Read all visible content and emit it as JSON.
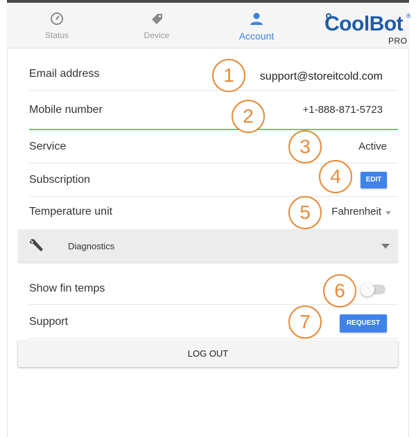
{
  "nav": {
    "tabs": [
      {
        "label": "Status",
        "icon": "speedometer-icon"
      },
      {
        "label": "Device",
        "icon": "tag-icon"
      },
      {
        "label": "Account",
        "icon": "person-icon",
        "active": true
      }
    ]
  },
  "logo": {
    "main": "CoolBot",
    "sub": "PRO",
    "reg": "®"
  },
  "account": {
    "email": {
      "label": "Email address",
      "value": "support@storeitcold.com"
    },
    "mobile": {
      "label": "Mobile number",
      "value": "+1-888-871-5723"
    },
    "service": {
      "label": "Service",
      "value": "Active"
    },
    "subscription": {
      "label": "Subscription",
      "button": "EDIT"
    },
    "temperature": {
      "label": "Temperature unit",
      "value": "Fahrenheit"
    },
    "diagnostics": {
      "label": "Diagnostics",
      "icon": "wrench-icon"
    },
    "fin_temps": {
      "label": "Show fin temps",
      "enabled": false
    },
    "support": {
      "label": "Support",
      "button": "REQUEST"
    },
    "logout": "LOG OUT"
  },
  "callouts": [
    "1",
    "2",
    "3",
    "4",
    "5",
    "6",
    "7"
  ],
  "colors": {
    "accent": "#3f82ec",
    "active_tab": "#3f82d9",
    "brand": "#1e5ca8",
    "callout": "#e88a3a",
    "focus_line": "#5dd07e"
  }
}
